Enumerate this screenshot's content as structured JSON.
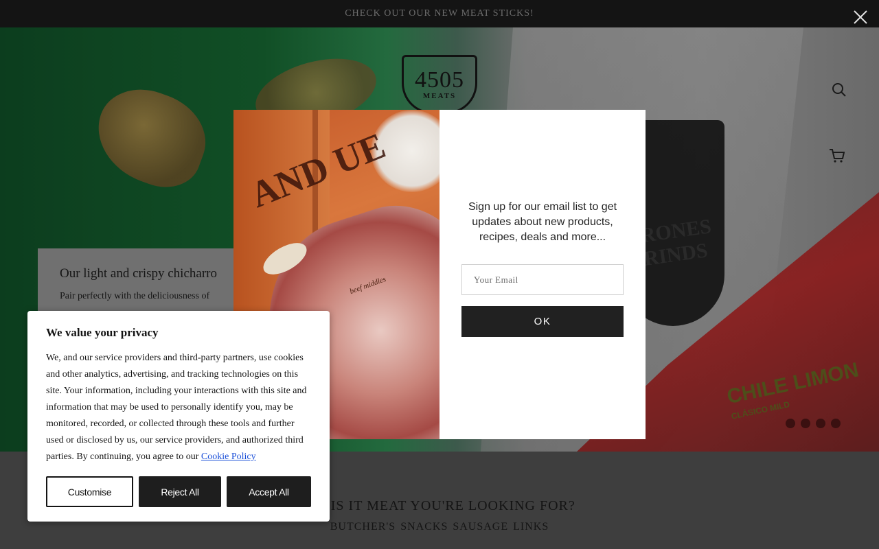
{
  "announcement": {
    "text": "CHECK OUT OUR NEW MEAT STICKS!"
  },
  "header": {
    "logo_number": "4505",
    "logo_word": "MEATS",
    "icons": [
      "search-icon",
      "cart-icon",
      "close-icon"
    ]
  },
  "hero": {
    "promo_heading": "Our light and crispy chicharro",
    "promo_text": "Pair perfectly with the deliciousness of",
    "bag_text": "RONES",
    "bag_text2": "RINDS",
    "chile_text": "CHILE LIMON",
    "chile_sub": "CLÁSICO MILD",
    "slides_total": 4
  },
  "modal": {
    "message": "Sign up for our email list to get updates about new products, recipes, deals and more...",
    "email_placeholder": "Your Email",
    "email_value": "",
    "ok_label": "OK",
    "image_text": "AND UE",
    "image_label": "beef middles"
  },
  "cookie": {
    "title": "We value your privacy",
    "body": "We, and our service providers and third-party partners, use cookies and other analytics, advertising, and tracking technologies on this site. Your information, including your interactions with this site and information that may be used to personally identify you, may be monitored, recorded, or collected through these tools and further used or disclosed by us, our service providers, and authorized third parties. By continuing, you agree to our",
    "policy_link": "Cookie Policy",
    "customise_label": "Customise",
    "reject_label": "Reject All",
    "accept_label": "Accept All"
  },
  "section": {
    "title": "SO, IS IT MEAT YOU'RE LOOKING FOR?",
    "links": "BUTCHER'S SNACKS SAUSAGE LINKS"
  },
  "colors": {
    "announce_bg": "#141414",
    "button_dark": "#212121",
    "link_blue": "#1a4fd8",
    "overlay_dark": "#3e3e3e"
  }
}
